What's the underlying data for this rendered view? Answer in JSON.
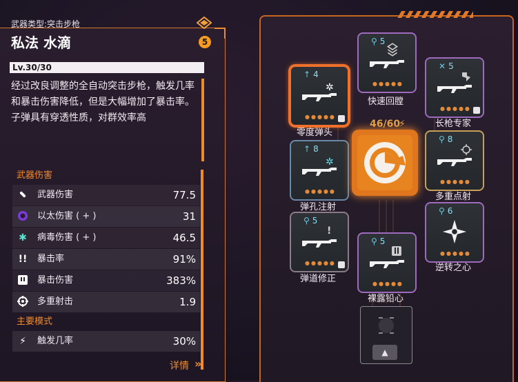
{
  "weapon": {
    "type_label": "武器类型:突击步枪",
    "name": "私法 水滴",
    "rarity": "5",
    "level": "Lv.30/30",
    "level_progress": 1.0,
    "description": "经过改良调整的全自动突击步枪，触发几率和暴击伤害降低，但是大幅增加了暴击率。子弹具有穿透性质，对群效率高"
  },
  "sections": {
    "weapon_damage": "武器伤害",
    "main_mode": "主要模式"
  },
  "stats": [
    {
      "label": "武器伤害",
      "value": "77.5",
      "icon": "bullet-icon"
    },
    {
      "label": "以太伤害 (  +  )",
      "value": "31",
      "icon": "ether-icon"
    },
    {
      "label": "病毒伤害 (  +  )",
      "value": "46.5",
      "icon": "virus-icon"
    },
    {
      "label": "暴击率",
      "value": "91%",
      "icon": "crit-rate-icon"
    },
    {
      "label": "暴击伤害",
      "value": "383%",
      "icon": "crit-damage-icon"
    },
    {
      "label": "多重射击",
      "value": "1.9",
      "icon": "multishot-icon"
    }
  ],
  "mode_stats": [
    {
      "label": "触发几率",
      "value": "30%",
      "icon": "trigger-icon"
    }
  ],
  "details_label": "详情",
  "core": {
    "capacity": "46/60"
  },
  "mods": [
    {
      "id": "quick-recover",
      "label": "快速回膛",
      "cost": "5",
      "rank_dots": "●●●●●"
    },
    {
      "id": "zero-bullet",
      "label": "零度弹头",
      "cost": "4",
      "rank_dots": "●●●●●"
    },
    {
      "id": "long-gun",
      "label": "长枪专家",
      "cost": "5",
      "rank_dots": "●●●●●"
    },
    {
      "id": "hole-inject",
      "label": "弹孔注射",
      "cost": "8",
      "rank_dots": "●●●●●"
    },
    {
      "id": "multi-point",
      "label": "多重点射",
      "cost": "8",
      "rank_dots": "●●●●●"
    },
    {
      "id": "trajectory",
      "label": "弹道修正",
      "cost": "5",
      "rank_dots": "●●●●●"
    },
    {
      "id": "reverse-heart",
      "label": "逆转之心",
      "cost": "6",
      "rank_dots": "●●●●●"
    },
    {
      "id": "naked-lead",
      "label": "裸露铅心",
      "cost": "5",
      "rank_dots": "●●●●●"
    }
  ],
  "slot_button": "▲",
  "colors": {
    "accent": "#f08a2e",
    "cost": "#8fdcf0"
  }
}
